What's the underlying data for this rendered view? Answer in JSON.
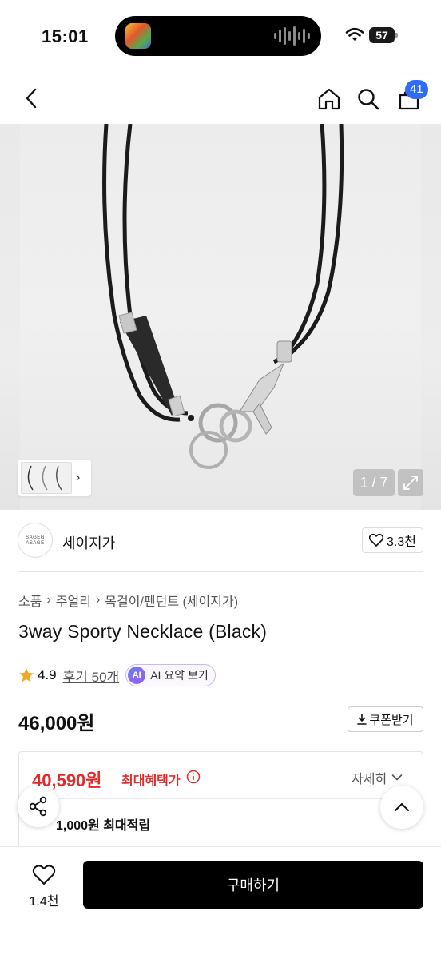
{
  "status_bar": {
    "time": "15:01",
    "battery": "57"
  },
  "header": {
    "cart_count": "41"
  },
  "gallery": {
    "page_counter": "1 / 7"
  },
  "brand": {
    "logo_text_line1": "SAGEG",
    "logo_text_line2": "ASAGE",
    "name": "세이지가",
    "like_count": "3.3천"
  },
  "breadcrumb": [
    "소품",
    "주얼리",
    "목걸이/펜던트 (세이지가)"
  ],
  "product": {
    "title": "3way Sporty Necklace (Black)",
    "rating": "4.9",
    "reviews": "후기 50개",
    "ai_badge": "AI",
    "ai_label": "AI 요약 보기",
    "price": "46,000원",
    "coupon_label": "쿠폰받기"
  },
  "benefit": {
    "best_price": "40,590원",
    "best_label": "최대혜택가",
    "detail_label": "자세히",
    "points_text": "1,000원 최대적립"
  },
  "bottom_bar": {
    "wish_count": "1.4천",
    "buy_label": "구매하기"
  },
  "colors": {
    "accent_red": "#e32b2b",
    "badge_blue": "#2f6cf5",
    "buy_button": "#000000"
  },
  "icons": [
    "wifi-icon",
    "back-icon",
    "home-icon",
    "search-icon",
    "cart-icon",
    "heart-icon",
    "star-icon",
    "info-icon",
    "share-icon",
    "chevron-up-icon",
    "expand-icon",
    "download-icon"
  ]
}
